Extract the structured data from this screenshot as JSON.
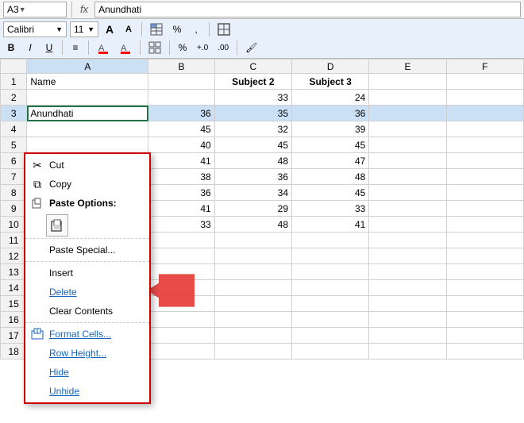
{
  "formulaBar": {
    "cellRef": "A3",
    "dropdownArrow": "▼",
    "fxLabel": "fx",
    "formulaValue": "Anundhati"
  },
  "ribbon": {
    "row1": {
      "fontName": "Calibri",
      "fontSize": "11",
      "growLabel": "A",
      "shrinkLabel": "A",
      "percentLabel": "%",
      "commaLabel": ","
    },
    "row2": {
      "boldLabel": "B",
      "italicLabel": "I",
      "underlineLabel": "U",
      "alignLeft": "≡",
      "borderLabel": "⊞",
      "percentLabel2": "%",
      "decimalUp": "+.0",
      "decimalDown": ".00",
      "paintLabel": "🖌"
    }
  },
  "columnHeaders": [
    "",
    "A",
    "B",
    "C",
    "D",
    "E",
    "F"
  ],
  "rows": [
    {
      "rowNum": "1",
      "cells": [
        "Name",
        "",
        "Subject 2",
        "Subject 3",
        "",
        ""
      ]
    },
    {
      "rowNum": "2",
      "cells": [
        "",
        "",
        "33",
        "24",
        "",
        ""
      ]
    },
    {
      "rowNum": "3",
      "cells": [
        "Anundhati",
        "36",
        "35",
        "36",
        "",
        ""
      ]
    },
    {
      "rowNum": "4",
      "cells": [
        "",
        "45",
        "32",
        "39",
        "",
        ""
      ]
    },
    {
      "rowNum": "5",
      "cells": [
        "",
        "40",
        "45",
        "45",
        "",
        ""
      ]
    },
    {
      "rowNum": "6",
      "cells": [
        "",
        "41",
        "48",
        "47",
        "",
        ""
      ]
    },
    {
      "rowNum": "7",
      "cells": [
        "",
        "38",
        "36",
        "48",
        "",
        ""
      ]
    },
    {
      "rowNum": "8",
      "cells": [
        "",
        "36",
        "34",
        "45",
        "",
        ""
      ]
    },
    {
      "rowNum": "9",
      "cells": [
        "",
        "41",
        "29",
        "33",
        "",
        ""
      ]
    },
    {
      "rowNum": "10",
      "cells": [
        "",
        "33",
        "48",
        "41",
        "",
        ""
      ]
    },
    {
      "rowNum": "11",
      "cells": [
        "",
        "",
        "",
        "",
        "",
        ""
      ]
    },
    {
      "rowNum": "12",
      "cells": [
        "",
        "",
        "",
        "",
        "",
        ""
      ]
    },
    {
      "rowNum": "13",
      "cells": [
        "",
        "",
        "",
        "",
        "",
        ""
      ]
    },
    {
      "rowNum": "14",
      "cells": [
        "",
        "",
        "",
        "",
        "",
        ""
      ]
    },
    {
      "rowNum": "15",
      "cells": [
        "",
        "",
        "",
        "",
        "",
        ""
      ]
    },
    {
      "rowNum": "16",
      "cells": [
        "",
        "",
        "",
        "",
        "",
        ""
      ]
    },
    {
      "rowNum": "17",
      "cells": [
        "",
        "",
        "",
        "",
        "",
        ""
      ]
    },
    {
      "rowNum": "18",
      "cells": [
        "",
        "",
        "",
        "",
        "",
        ""
      ]
    }
  ],
  "contextMenu": {
    "items": [
      {
        "id": "cut",
        "label": "Cut",
        "icon": "✂",
        "type": "normal"
      },
      {
        "id": "copy",
        "label": "Copy",
        "icon": "⧉",
        "type": "normal"
      },
      {
        "id": "paste-options-header",
        "label": "Paste Options:",
        "type": "header"
      },
      {
        "id": "paste-icon",
        "label": "",
        "type": "paste-icon"
      },
      {
        "id": "sep1",
        "type": "separator"
      },
      {
        "id": "paste-special",
        "label": "Paste Special...",
        "type": "normal"
      },
      {
        "id": "sep2",
        "type": "separator"
      },
      {
        "id": "insert",
        "label": "Insert",
        "type": "normal"
      },
      {
        "id": "delete",
        "label": "Delete",
        "type": "link"
      },
      {
        "id": "clear-contents",
        "label": "Clear Contents",
        "type": "normal"
      },
      {
        "id": "sep3",
        "type": "separator"
      },
      {
        "id": "format-cells",
        "label": "Format Cells...",
        "icon": "⊟",
        "type": "link"
      },
      {
        "id": "row-height",
        "label": "Row Height...",
        "type": "link"
      },
      {
        "id": "hide",
        "label": "Hide",
        "type": "link"
      },
      {
        "id": "unhide",
        "label": "Unhide",
        "type": "link"
      }
    ]
  }
}
